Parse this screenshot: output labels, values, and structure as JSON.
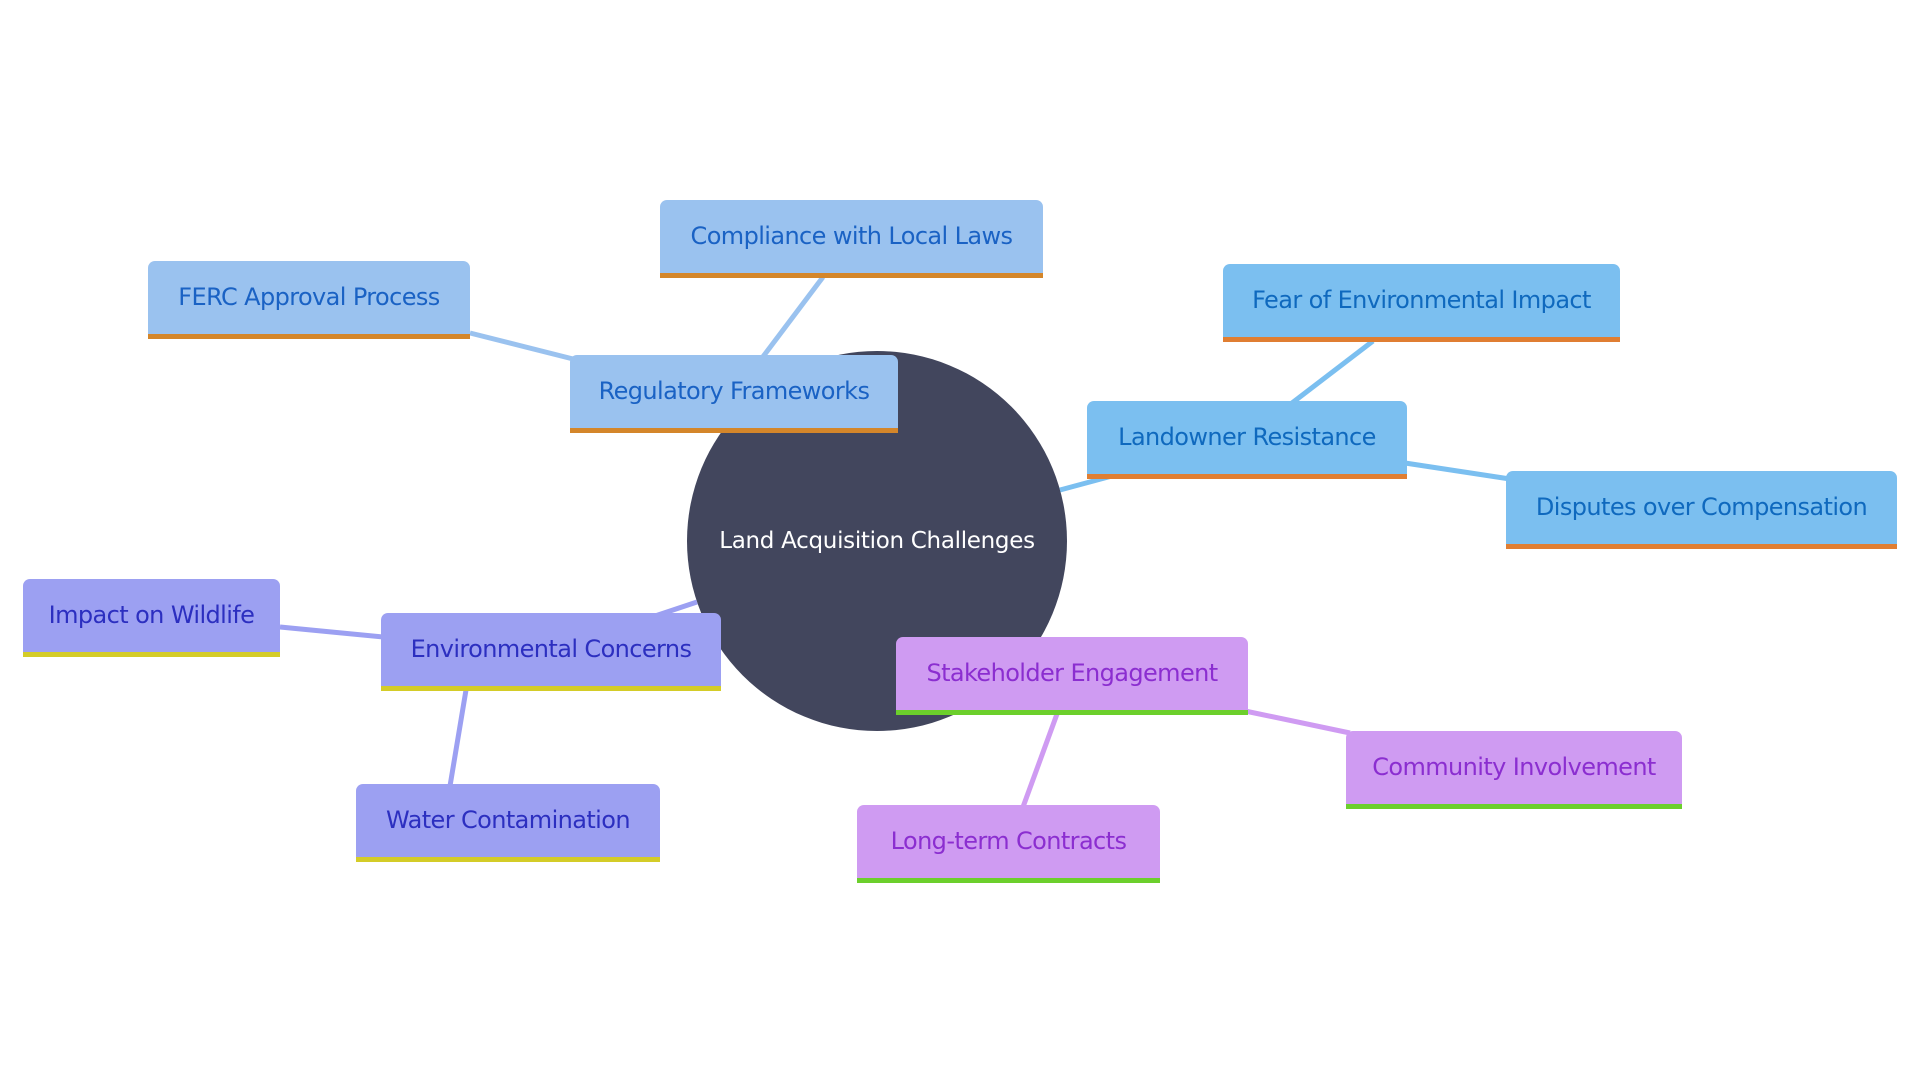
{
  "mindmap": {
    "root": {
      "label": "Land Acquisition Challenges",
      "color": "#42465d"
    },
    "branches": [
      {
        "id": "regulatory",
        "label": "Regulatory Frameworks",
        "fill": "#9ac2ef",
        "text_color": "#1a62c4",
        "accent": "#d4862a",
        "children": [
          {
            "label": "FERC Approval Process"
          },
          {
            "label": "Compliance with Local Laws"
          }
        ]
      },
      {
        "id": "landowner",
        "label": "Landowner Resistance",
        "fill": "#7bbff0",
        "text_color": "#0f69be",
        "accent": "#e07e32",
        "children": [
          {
            "label": "Fear of Environmental Impact"
          },
          {
            "label": "Disputes over Compensation"
          }
        ]
      },
      {
        "id": "environmental",
        "label": "Environmental Concerns",
        "fill": "#9ca0f2",
        "text_color": "#2c2fc0",
        "accent": "#d4cc28",
        "children": [
          {
            "label": "Impact on Wildlife"
          },
          {
            "label": "Water Contamination"
          }
        ]
      },
      {
        "id": "stakeholder",
        "label": "Stakeholder Engagement",
        "fill": "#cf9bf2",
        "text_color": "#8b2ed0",
        "accent": "#6ccf2c",
        "children": [
          {
            "label": "Community Involvement"
          },
          {
            "label": "Long-term Contracts"
          }
        ]
      }
    ]
  }
}
